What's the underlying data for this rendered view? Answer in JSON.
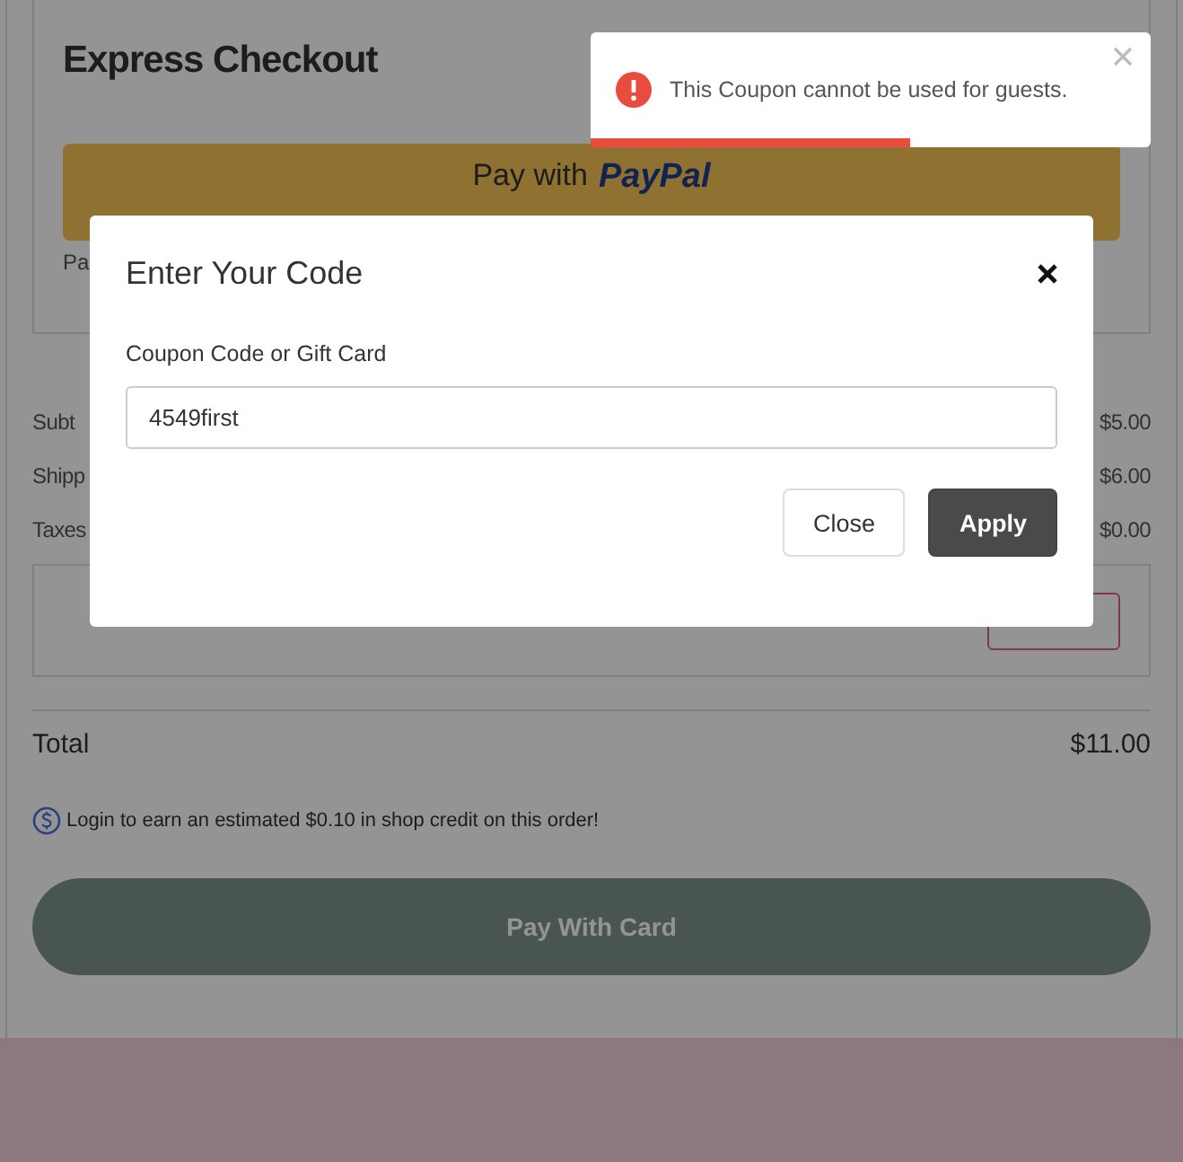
{
  "page": {
    "express_checkout": {
      "title": "Express Checkout",
      "paypal_label": "Pay with",
      "paypal_logo": "PayPal",
      "note": "Pa"
    },
    "summary": [
      {
        "label": "Subt",
        "amount": "$5.00"
      },
      {
        "label": "Shipp",
        "amount": "$6.00"
      },
      {
        "label": "Taxes",
        "amount": "$0.00"
      }
    ],
    "total": {
      "label": "Total",
      "amount": "$11.00"
    },
    "credit_note": "Login to earn an estimated $0.10 in shop credit on this order!",
    "pay_button": "Pay With Card"
  },
  "modal": {
    "title": "Enter Your Code",
    "field_label": "Coupon Code or Gift Card",
    "field_value": "4549first",
    "buttons": [
      {
        "label": "Close",
        "kind": "secondary"
      },
      {
        "label": "Apply",
        "kind": "primary"
      }
    ]
  },
  "toast": {
    "message": "This Coupon cannot be used for guests.",
    "level": 0.57
  }
}
